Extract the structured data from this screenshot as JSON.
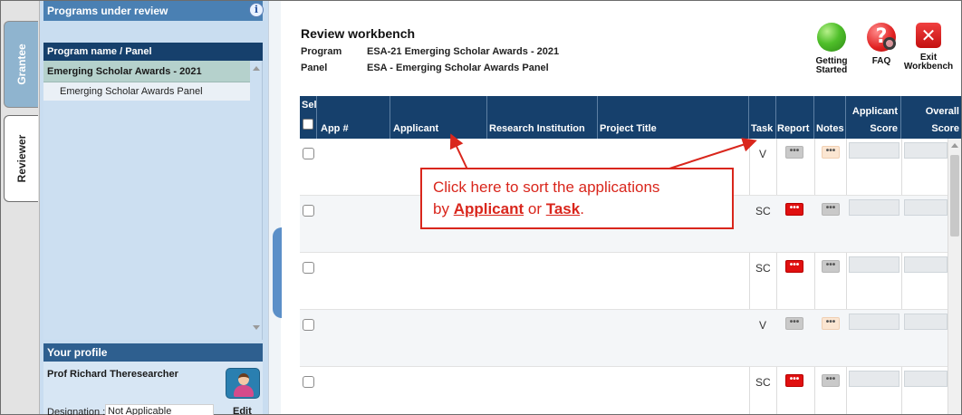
{
  "tabs": {
    "grantee": "Grantee",
    "reviewer": "Reviewer"
  },
  "programs_panel": {
    "title": "Programs under review",
    "info_glyph": "i",
    "column_header": "Program name / Panel",
    "program": "Emerging Scholar Awards - 2021",
    "panel": "Emerging Scholar Awards Panel"
  },
  "profile": {
    "title": "Your profile",
    "name": "Prof Richard Theresearcher",
    "designation_label": "Designation :",
    "designation_value": "Not Applicable",
    "edit_label": "Edit"
  },
  "workbench": {
    "title": "Review workbench",
    "program_label": "Program",
    "program_value": "ESA-21 Emerging Scholar Awards - 2021",
    "panel_label": "Panel",
    "panel_value": "ESA - Emerging Scholar Awards Panel"
  },
  "toolbar": {
    "getting_started_1": "Getting",
    "getting_started_2": "Started",
    "faq": "FAQ",
    "faq_glyph": "?",
    "exit_1": "Exit",
    "exit_2": "Workbench",
    "exit_glyph": "✕"
  },
  "grid": {
    "headers": {
      "sel": "Sel",
      "app": "App #",
      "applicant": "Applicant",
      "institution": "Research Institution",
      "title": "Project Title",
      "task": "Task",
      "report": "Report",
      "notes": "Notes",
      "applicant_score_1": "Applicant",
      "applicant_score_2": "Score",
      "overall_score_1": "Overall",
      "overall_score_2": "Score"
    },
    "rows": [
      {
        "task": "V",
        "report": "•••",
        "notes": "•••"
      },
      {
        "task": "SC",
        "report": "•••",
        "notes": "•••"
      },
      {
        "task": "SC",
        "report": "•••",
        "notes": "•••"
      },
      {
        "task": "V",
        "report": "•••",
        "notes": "•••"
      },
      {
        "task": "SC",
        "report": "•••",
        "notes": "•••"
      }
    ]
  },
  "callout": {
    "line1": "Click here to sort the applications",
    "by": "by ",
    "applicant": "Applicant",
    "or": " or ",
    "task": "Task",
    "end": "."
  },
  "colors": {
    "header_navy": "#16406c",
    "side_bg": "#c9ddf0",
    "callout_red": "#d9261c",
    "report_red": "#e01010"
  }
}
